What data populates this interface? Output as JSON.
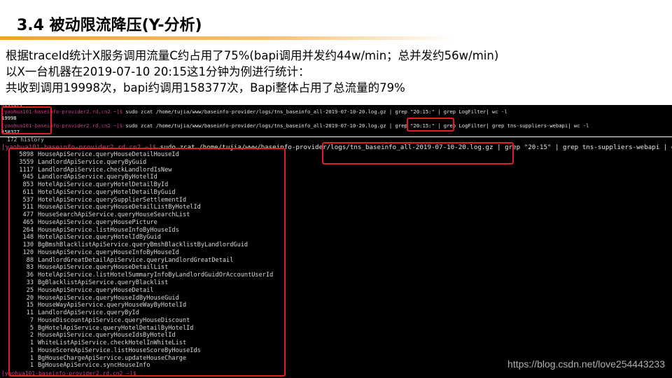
{
  "slide": {
    "title": "3.4 被动限流降压(Y-分析)",
    "lines": [
      "根据traceId统计X服务调用流量C约占用了75%(bapi调用并发约44w/min；总并发约56w/min)",
      "以X一台机器在2019-07-10 20:15这1分钟为例进行统计：",
      "共收到调用19998次，bapi约调用158377次，Bapi整体占用了总流量的79%"
    ]
  },
  "terminal_top": {
    "history_label": "history",
    "prompt": "[yaohua101-baseinfo-provider2.rd.cn2 ~]$",
    "cmd1": " sudo zcat /home/tujia/www/baseinfo-provider/logs/tns_baseinfo_all-2019-07-10-20.log.gz | grep \"20:15:\" | grep LogFilter| wc -l",
    "result1": "19998",
    "cmd2": " sudo zcat /home/tujia/www/baseinfo-provider/logs/tns_baseinfo_all-2019-07-10-20.log.gz | grep \"20:15:\" | grep LogFilter| grep tns-suppliers-webapi| wc -l",
    "result2": "158377"
  },
  "terminal_main": {
    "history_line": "172  history",
    "prompt": "[yaohua101-baseinfo-provider2.rd.cn2 ~]$",
    "cmd": " sudo zcat /home/tujia/www/baseinfo-provider/logs/tns_baseinfo_all-2019-07-10-20.log.gz | grep \"20:15\" | grep tns-suppliers-webapi | grep LogFilter|",
    "rows": [
      {
        "count": "5898",
        "method": "HouseApiService.queryHouseDetailHouseId"
      },
      {
        "count": "3559",
        "method": "LandlordApiService.queryByGuid"
      },
      {
        "count": "1117",
        "method": "LandlordApiService.checkLandlordIsNew"
      },
      {
        "count": "945",
        "method": "LandlordApiService.queryByHotelId"
      },
      {
        "count": "853",
        "method": "HotelApiService.queryHotelDetailById"
      },
      {
        "count": "611",
        "method": "HotelApiService.queryHotelDetailByGuid"
      },
      {
        "count": "537",
        "method": "HotelApiService.querySupplierSettlementId"
      },
      {
        "count": "511",
        "method": "HouseApiService.queryHouseDetailListByHotelId"
      },
      {
        "count": "477",
        "method": "HouseSearchApiService.queryHouseSearchList"
      },
      {
        "count": "465",
        "method": "HouseApiService.queryHousePicture"
      },
      {
        "count": "264",
        "method": "HouseApiService.listHouseInfoByHouseIds"
      },
      {
        "count": "148",
        "method": "HotelApiService.queryHotelIdByGuid"
      },
      {
        "count": "130",
        "method": "BgBmshBlacklistApiService.queryBmshBlacklistByLandlordGuid"
      },
      {
        "count": "120",
        "method": "HouseApiService.queryHouseInfoByHouseId"
      },
      {
        "count": "88",
        "method": "LandlordGreatDetailApiService.queryLandlordGreatDetail"
      },
      {
        "count": "83",
        "method": "HouseApiService.queryHouseDetailList"
      },
      {
        "count": "36",
        "method": "HotelApiService.listHotelSummaryInfoByLandlordGuidOrAccountUserId"
      },
      {
        "count": "33",
        "method": "BgBlacklistApiService.queryBlacklist"
      },
      {
        "count": "25",
        "method": "HouseApiService.queryHouseDetail"
      },
      {
        "count": "20",
        "method": "HouseApiService.queryHouseIdByHouseGuid"
      },
      {
        "count": "15",
        "method": "HouseWayApiService.queryHouseWayByHotelId"
      },
      {
        "count": "11",
        "method": "LandlordApiService.queryById"
      },
      {
        "count": "7",
        "method": "HouseDiscountApiService.queryHouseDiscount"
      },
      {
        "count": "5",
        "method": "BgHotelApiService.queryHotelDetailByHotelId"
      },
      {
        "count": "2",
        "method": "HouseApiService.queryHouseIdsByHotelId"
      },
      {
        "count": "1",
        "method": "WhiteListApiService.checkHotelInWhiteList"
      },
      {
        "count": "1",
        "method": "HouseScoreApiService.listHouseScoreByHouseIds"
      },
      {
        "count": "1",
        "method": "BgHouseChargeApiService.updateHouseCharge"
      },
      {
        "count": "1",
        "method": "BgHouseApiService.syncHouseInfo"
      }
    ]
  },
  "watermark": "https://blog.csdn.net/love254443233",
  "colors": {
    "accent": "#f0a030",
    "highlight_box": "#e02020",
    "prompt": "#cc3d8a",
    "terminal_bg": "#000000"
  }
}
